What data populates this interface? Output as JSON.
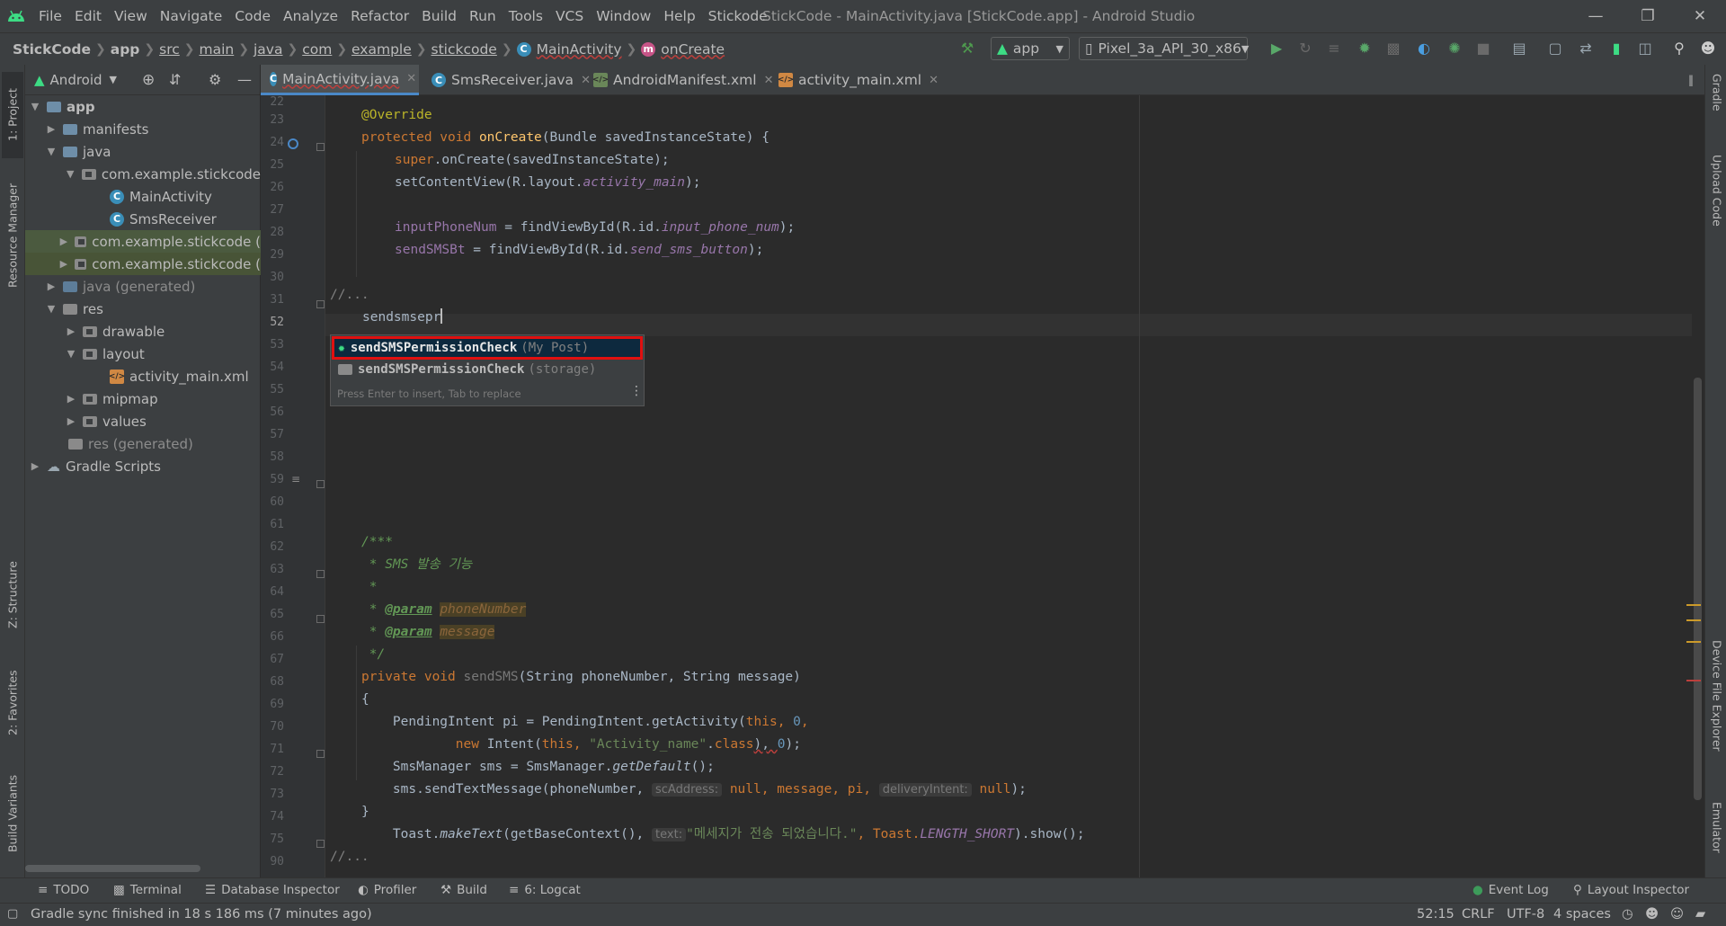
{
  "window": {
    "title": "StickCode - MainActivity.java [StickCode.app] - Android Studio",
    "menu": [
      "File",
      "Edit",
      "View",
      "Navigate",
      "Code",
      "Analyze",
      "Refactor",
      "Build",
      "Run",
      "Tools",
      "VCS",
      "Window",
      "Help",
      "Stickode"
    ]
  },
  "breadcrumb": [
    "StickCode",
    "app",
    "src",
    "main",
    "java",
    "com",
    "example",
    "stickcode",
    "MainActivity",
    "onCreate"
  ],
  "toolbar": {
    "run_config": "app",
    "device": "Pixel_3a_API_30_x86"
  },
  "left_tool_tabs": [
    "1: Project",
    "Resource Manager",
    "Z: Structure",
    "2: Favorites",
    "Build Variants"
  ],
  "right_tool_tabs": [
    "Gradle",
    "Upload Code",
    "Device File Explorer",
    "Emulator"
  ],
  "project": {
    "view_mode": "Android",
    "tree": [
      {
        "label": "app",
        "depth": 0,
        "icon": "folder",
        "expanded": true
      },
      {
        "label": "manifests",
        "depth": 1,
        "icon": "folder",
        "expanded": false
      },
      {
        "label": "java",
        "depth": 1,
        "icon": "folder",
        "expanded": true
      },
      {
        "label": "com.example.stickcode",
        "depth": 2,
        "icon": "package",
        "expanded": true
      },
      {
        "label": "MainActivity",
        "depth": 3,
        "icon": "class"
      },
      {
        "label": "SmsReceiver",
        "depth": 3,
        "icon": "class"
      },
      {
        "label": "com.example.stickcode (",
        "depth": 2,
        "icon": "package",
        "expanded": false
      },
      {
        "label": "com.example.stickcode (",
        "depth": 2,
        "icon": "package",
        "expanded": false
      },
      {
        "label": "java (generated)",
        "depth": 1,
        "icon": "folder-gen",
        "expanded": false
      },
      {
        "label": "res",
        "depth": 1,
        "icon": "folder",
        "expanded": true
      },
      {
        "label": "drawable",
        "depth": 2,
        "icon": "folder",
        "expanded": false
      },
      {
        "label": "layout",
        "depth": 2,
        "icon": "folder",
        "expanded": true
      },
      {
        "label": "activity_main.xml",
        "depth": 3,
        "icon": "xml"
      },
      {
        "label": "mipmap",
        "depth": 2,
        "icon": "folder",
        "expanded": false
      },
      {
        "label": "values",
        "depth": 2,
        "icon": "folder",
        "expanded": false
      },
      {
        "label": "res (generated)",
        "depth": 1,
        "icon": "folder-gen"
      },
      {
        "label": "Gradle Scripts",
        "depth": 0,
        "icon": "gradle",
        "expanded": false
      }
    ]
  },
  "editor_tabs": [
    {
      "label": "MainActivity.java",
      "active": true,
      "icon": "class"
    },
    {
      "label": "SmsReceiver.java",
      "active": false,
      "icon": "class"
    },
    {
      "label": "AndroidManifest.xml",
      "active": false,
      "icon": "xml"
    },
    {
      "label": "activity_main.xml",
      "active": false,
      "icon": "xml"
    }
  ],
  "code": {
    "line_numbers": [
      "22",
      "23",
      "24",
      "25",
      "26",
      "27",
      "28",
      "29",
      "30",
      "31",
      "52",
      "53",
      "54",
      "55",
      "56",
      "57",
      "58",
      "59",
      "60",
      "61",
      "62",
      "63",
      "64",
      "65",
      "66",
      "67",
      "68",
      "69",
      "70",
      "71",
      "72",
      "73",
      "74",
      "75",
      "90"
    ],
    "l23": "@Override",
    "l24_kw": "protected void ",
    "l24_fn": "onCreate",
    "l24_rest": "(Bundle savedInstanceState) {",
    "l25_kw": "super",
    "l25_rest": ".onCreate(savedInstanceState);",
    "l26_a": "setContentView(R.layout.",
    "l26_b": "activity_main",
    "l26_c": ");",
    "l28_a": "inputPhoneNum",
    "l28_b": " = findViewById(R.id.",
    "l28_c": "input_phone_num",
    "l28_d": ");",
    "l29_a": "sendSMSBt",
    "l29_b": " = findViewById(R.id.",
    "l29_c": "send_sms_button",
    "l29_d": ");",
    "l31": "//...",
    "l52": "sendsmsepr",
    "l58": "/***",
    "l59": " * SMS 발송 기능",
    "l60": " *",
    "l61_a": " * ",
    "l61_tag": "@param",
    "l61_p": "phoneNumber",
    "l62_a": " * ",
    "l62_tag": "@param",
    "l62_p": "message",
    "l63": " */",
    "l64_kw": "private void ",
    "l64_fn": "sendSMS",
    "l64_rest": "(String phoneNumber, String message)",
    "l65": "{",
    "l66_a": "    PendingIntent pi = PendingIntent.getActivity(",
    "l66_kw": "this",
    "l66_b": ", ",
    "l66_num": "0",
    "l66_c": ",",
    "l67_pad": "            ",
    "l67_kw": "new ",
    "l67_a": "Intent(",
    "l67_kw2": "this",
    "l67_b": ", ",
    "l67_str": "\"Activity_name\"",
    "l67_c": ".",
    "l67_kw3": "class",
    "l67_d": "), ",
    "l67_num": "0",
    "l67_e": ");",
    "l68_a": "    SmsManager sms = SmsManager.",
    "l68_b": "getDefault",
    "l68_c": "();",
    "l69_a": "    sms.sendTextMessage(phoneNumber, ",
    "l69_h1": "scAddress:",
    "l69_kw1": " null",
    "l69_b": ", message, pi, ",
    "l69_h2": "deliveryIntent:",
    "l69_kw2": " null",
    "l69_c": ");",
    "l71_a": "    Toast.",
    "l71_b": "makeText",
    "l71_c": "(getBaseContext(), ",
    "l71_h": "text:",
    "l71_str": "\"메세지가 전송 되었습니다.\"",
    "l71_d": ", Toast.",
    "l71_e": "LENGTH_SHORT",
    "l71_f": ").show();",
    "l72": "}",
    "l75": "//..."
  },
  "completion": {
    "items": [
      {
        "name": "sendSMSPermissionCheck",
        "location": "(My Post)",
        "icon": "stickode-icon",
        "selected": true
      },
      {
        "name": "sendSMSPermissionCheck",
        "location": "(storage)",
        "icon": "folder-icon",
        "selected": false
      }
    ],
    "hint": "Press Enter to insert, Tab to replace"
  },
  "bottom_tools": [
    "TODO",
    "Terminal",
    "Database Inspector",
    "Profiler",
    "Build",
    "6: Logcat",
    "Event Log",
    "Layout Inspector"
  ],
  "status": {
    "message": "Gradle sync finished in 18 s 186 ms (7 minutes ago)",
    "position": "52:15",
    "line_sep": "CRLF",
    "encoding": "UTF-8",
    "indent": "4 spaces"
  }
}
